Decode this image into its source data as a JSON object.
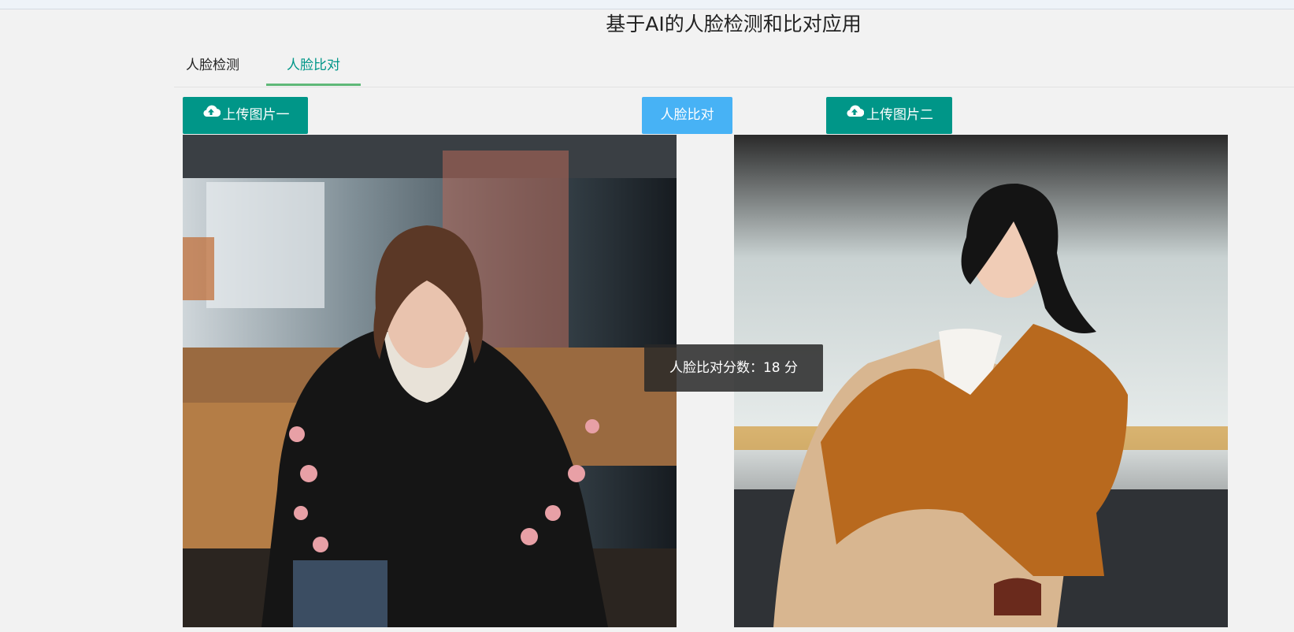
{
  "header": {
    "title": "基于AI的人脸检测和比对应用"
  },
  "tabs": [
    {
      "label": "人脸检测",
      "active": false
    },
    {
      "label": "人脸比对",
      "active": true
    }
  ],
  "actions": {
    "upload_one": "上传图片一",
    "compare": "人脸比对",
    "upload_two": "上传图片二"
  },
  "result": {
    "message": "人脸比对分数：18 分"
  },
  "colors": {
    "primary": "#009688",
    "accent_blue": "#47b2f5",
    "tab_underline": "#5fb878",
    "background": "#f2f2f2"
  },
  "icons": {
    "upload": "cloud-upload-icon"
  }
}
